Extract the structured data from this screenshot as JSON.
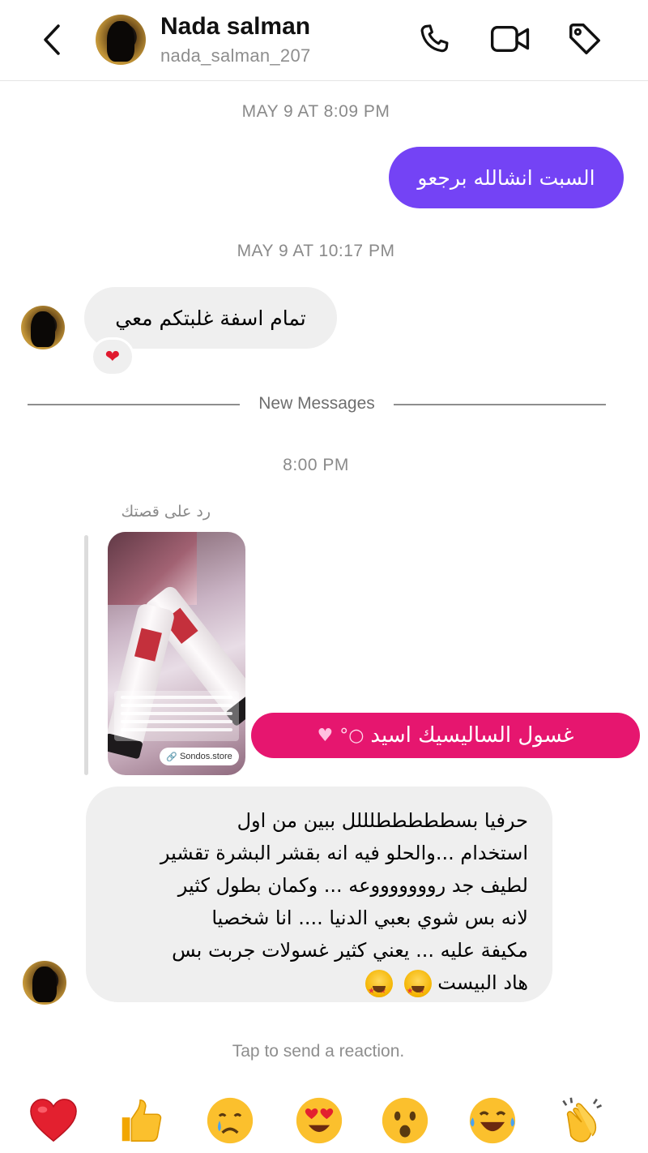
{
  "header": {
    "name": "Nada salman",
    "username": "nada_salman_207",
    "icons": [
      "back-chevron-icon",
      "phone-icon",
      "video-camera-icon",
      "tag-icon"
    ]
  },
  "messages": {
    "ts1": "MAY 9 AT 8:09 PM",
    "out1": "السبت انشالله برجعو",
    "ts2": "MAY 9 AT 10:17 PM",
    "in1": "تمام اسفة غلبتكم معي",
    "in1_reaction": "❤",
    "divider": "New Messages",
    "ts3": "8:00 PM",
    "story_label": "رد على قصتك",
    "story_store": "Sondos.store",
    "out2": "غسول الساليسيك اسيد",
    "in2_lines": [
      "حرفيا بسطططططلللل ببين من اول",
      "استخدام ...والحلو فيه انه بقشر البشرة تقشير",
      "لطيف جد روووووووعه ... وكمان بطول كثير",
      "لانه بس شوي بعبي الدنيا .... انا شخصيا",
      "مكيفة عليه ... يعني كثير غسولات جربت بس",
      "هاد البيست"
    ]
  },
  "footer": {
    "tap_hint": "Tap to send a reaction.",
    "reactions": [
      "heart",
      "thumbs-up",
      "crying-face",
      "heart-eyes-face",
      "surprised-face",
      "laughing-tears-face",
      "clapping-hands"
    ]
  },
  "colors": {
    "outgoing_purple": "#7443f5",
    "outgoing_pink": "#e6166f",
    "incoming_gray": "#efefef"
  }
}
